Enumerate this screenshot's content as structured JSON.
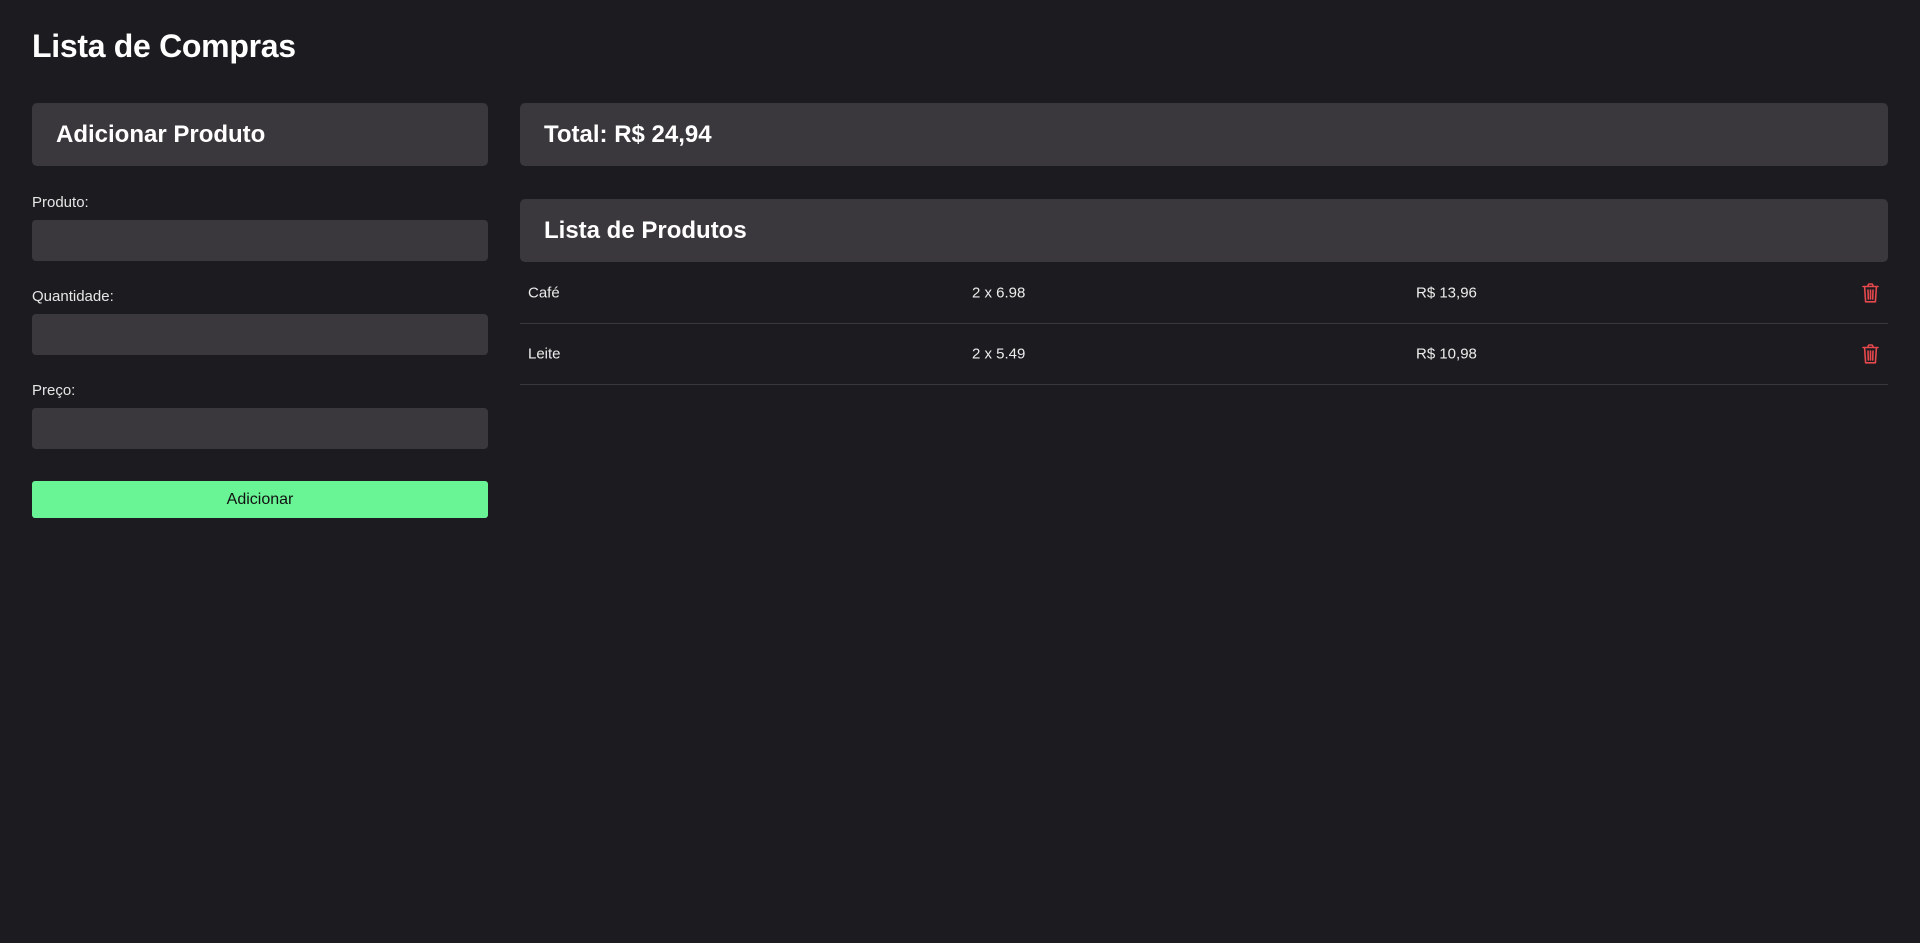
{
  "page": {
    "title": "Lista de Compras"
  },
  "form": {
    "title": "Adicionar Produto",
    "fields": [
      {
        "label": "Produto:",
        "value": "",
        "placeholder": ""
      },
      {
        "label": "Quantidade:",
        "value": "",
        "placeholder": ""
      },
      {
        "label": "Preço:",
        "value": "",
        "placeholder": ""
      }
    ],
    "submit_label": "Adicionar"
  },
  "summary": {
    "total_label": "Total: R$ 24,94"
  },
  "list": {
    "title": "Lista de Produtos",
    "items": [
      {
        "name": "Café",
        "quantity_price": "2 x 6.98",
        "total": "R$ 13,96",
        "delete_icon": "trash-icon"
      },
      {
        "name": "Leite",
        "quantity_price": "2 x 5.49",
        "total": "R$ 10,98",
        "delete_icon": "trash-icon"
      }
    ]
  },
  "colors": {
    "background": "#1c1b1f",
    "panel": "#3a383d",
    "accent_button": "#69f595",
    "delete_icon": "#e5484d"
  }
}
